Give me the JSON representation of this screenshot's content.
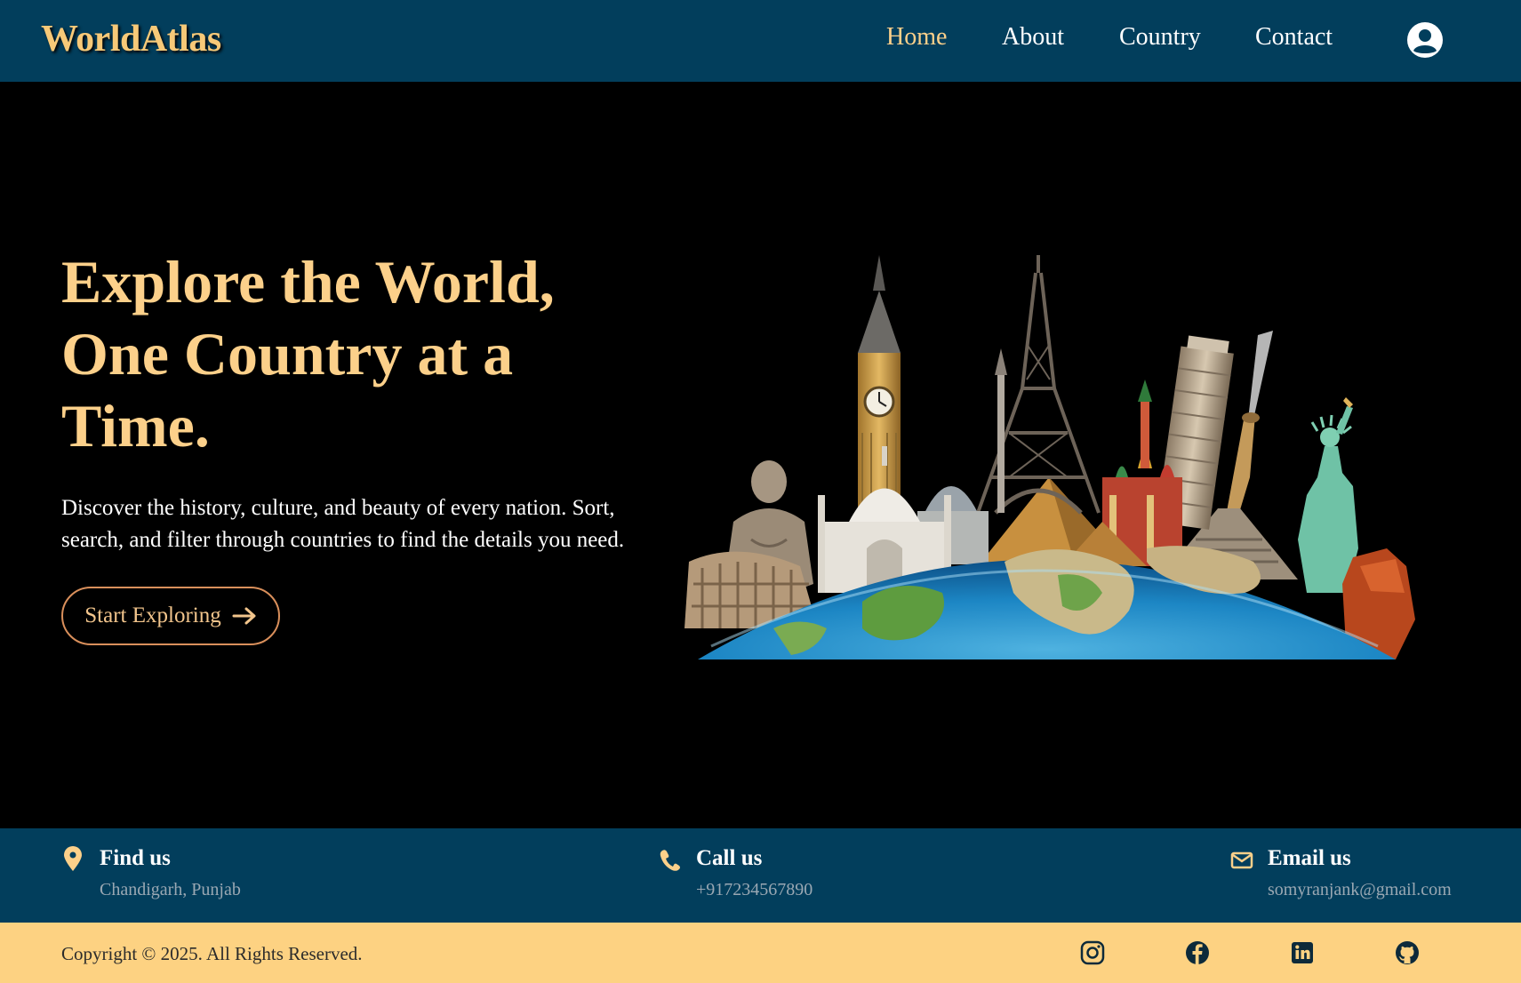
{
  "header": {
    "logo": "WorldAtlas",
    "nav": [
      {
        "label": "Home",
        "active": true
      },
      {
        "label": "About",
        "active": false
      },
      {
        "label": "Country",
        "active": false
      },
      {
        "label": "Contact",
        "active": false
      }
    ],
    "user_icon": "user-circle-icon"
  },
  "hero": {
    "title": "Explore the World, One Country at a Time.",
    "description": "Discover the history, culture, and beauty of every nation. Sort, search, and filter through countries to find the details you need.",
    "cta_label": "Start Exploring",
    "cta_icon": "arrow-right-icon",
    "image": "world-landmarks-globe-illustration"
  },
  "info": {
    "find": {
      "title": "Find us",
      "value": "Chandigarh, Punjab",
      "icon": "map-pin-icon"
    },
    "call": {
      "title": "Call us",
      "value": "+917234567890",
      "icon": "phone-icon"
    },
    "email": {
      "title": "Email us",
      "value": "somyranjank@gmail.com",
      "icon": "mail-icon"
    }
  },
  "footer": {
    "copyright": "Copyright © 2025. All Rights Reserved.",
    "social": [
      "instagram-icon",
      "facebook-icon",
      "linkedin-icon",
      "github-icon"
    ]
  },
  "colors": {
    "navy": "#023e5c",
    "accent": "#fcd08a",
    "footer_bg": "#fdd282",
    "cta_border": "#d98f5b"
  }
}
